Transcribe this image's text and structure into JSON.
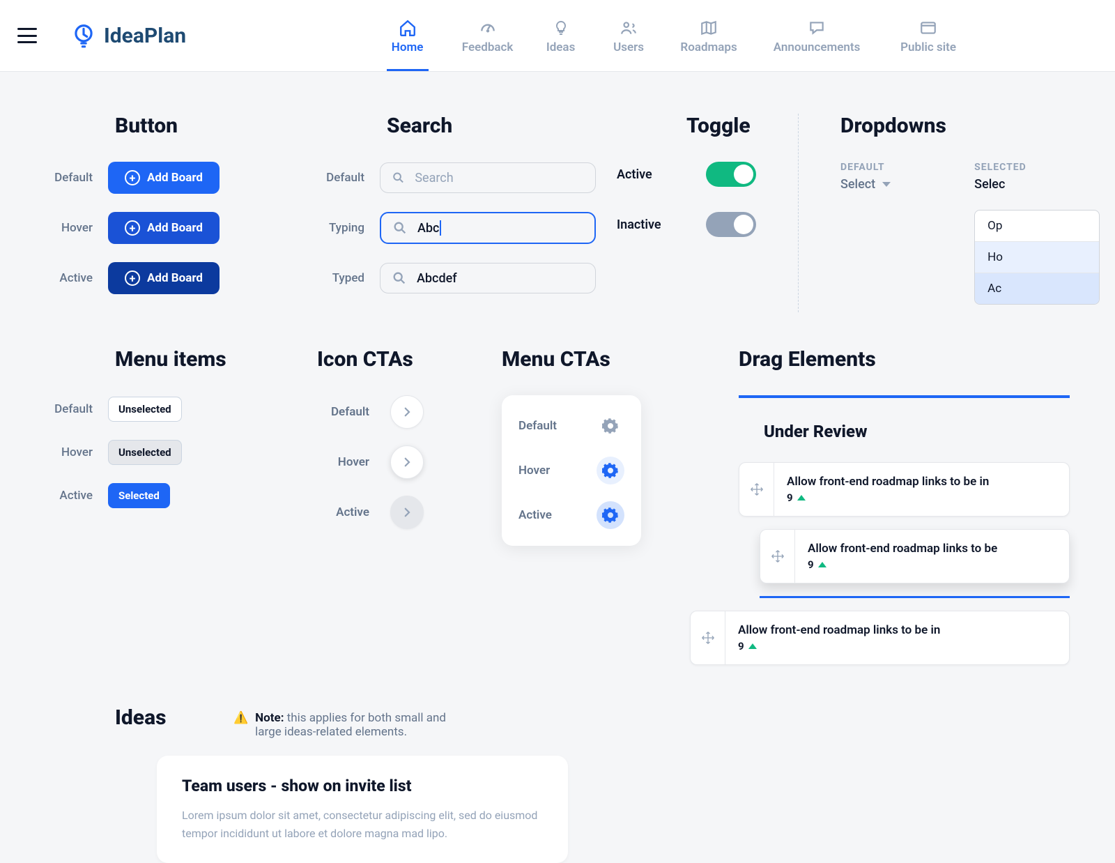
{
  "brand": "IdeaPlan",
  "nav": {
    "home": "Home",
    "feedback": "Feedback",
    "ideas": "Ideas",
    "users": "Users",
    "roadmaps": "Roadmaps",
    "announcements": "Announcements",
    "publicsite": "Public site"
  },
  "labels": {
    "default": "Default",
    "hover": "Hover",
    "active": "Active",
    "typing": "Typing",
    "typed": "Typed",
    "inactive": "Inactive"
  },
  "sections": {
    "button": "Button",
    "search": "Search",
    "toggle": "Toggle",
    "dropdowns": "Dropdowns",
    "menu_items": "Menu items",
    "icon_ctas": "Icon CTAs",
    "menu_ctas": "Menu CTAs",
    "drag_elements": "Drag Elements",
    "ideas": "Ideas"
  },
  "button": {
    "label": "Add Board"
  },
  "search": {
    "placeholder": "Search",
    "typing_value": "Abc",
    "typed_value": "Abcdef"
  },
  "toggle": {
    "active_label": "Active",
    "inactive_label": "Inactive"
  },
  "dropdown": {
    "default_caption": "DEFAULT",
    "selected_caption": "SELECTED",
    "select": "Select",
    "selected_value": "Selec",
    "opt1": "Op",
    "opt2": "Ho",
    "opt3": "Ac"
  },
  "menu_items": {
    "unselected": "Unselected",
    "selected": "Selected"
  },
  "drag": {
    "header": "Under Review",
    "item_title": "Allow front-end roadmap links to be in",
    "item_title2": "Allow front-end roadmap links to be",
    "count": "9"
  },
  "ideas": {
    "note_label": "Note:",
    "note_body": "this applies for both small and large ideas-related elements.",
    "card_title": "Team users - show on invite list",
    "card_body": "Lorem ipsum dolor sit amet, consectetur adipiscing elit, sed do eiusmod tempor incididunt ut labore et dolore magna mad lipo."
  }
}
